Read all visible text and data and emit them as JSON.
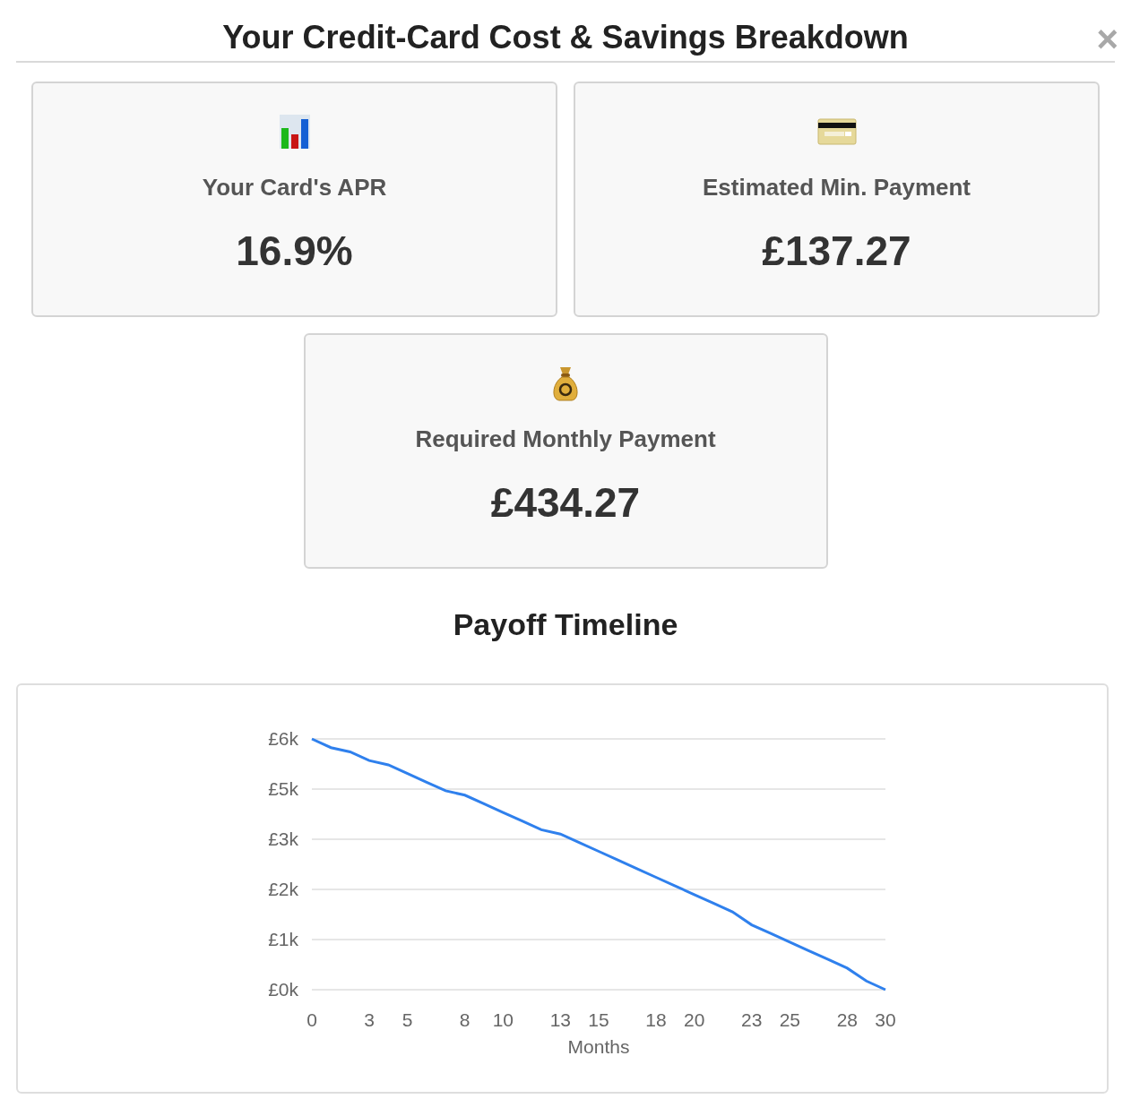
{
  "dialog": {
    "title": "Your Credit-Card Cost & Savings Breakdown",
    "close": "×"
  },
  "stat_cards": [
    {
      "kind": "chart",
      "label": "Your Card's APR",
      "value": "16.9%"
    },
    {
      "kind": "card",
      "label": "Estimated Min. Payment",
      "value": "£137.27"
    },
    {
      "kind": "moneybag",
      "label": "Required Monthly Payment",
      "value": "£434.27"
    }
  ],
  "payoff_section": {
    "chart_data": {
      "type": "line",
      "title": "Payoff Timeline",
      "xlabel": "Months",
      "x": [
        0,
        1,
        2,
        3,
        4,
        5,
        6,
        7,
        8,
        9,
        10,
        11,
        12,
        13,
        14,
        15,
        16,
        17,
        18,
        19,
        20,
        21,
        22,
        23,
        24,
        25,
        26,
        27,
        28,
        29,
        30
      ],
      "series": [
        {
          "color": "#2f80ed",
          "values": [
            5.8,
            5.6,
            5.5,
            5.3,
            5.2,
            5.0,
            4.8,
            4.6,
            4.5,
            4.3,
            4.1,
            3.9,
            3.7,
            3.6,
            3.4,
            3.2,
            3.0,
            2.8,
            2.6,
            2.4,
            2.2,
            2.0,
            1.8,
            1.5,
            1.3,
            1.1,
            0.9,
            0.7,
            0.5,
            0.2,
            0
          ]
        }
      ],
      "xlim": [
        0,
        30
      ],
      "ylim": [
        0,
        5.8
      ],
      "grid": true,
      "xticks": [
        0,
        3,
        5,
        8,
        10,
        13,
        15,
        18,
        20,
        23,
        25,
        28,
        30
      ],
      "yticks": [
        {
          "value": 0,
          "label": "£0k"
        },
        {
          "value": 1.16,
          "label": "£1k"
        },
        {
          "value": 2.32,
          "label": "£2k"
        },
        {
          "value": 3.48,
          "label": "£3k"
        },
        {
          "value": 4.64,
          "label": "£5k"
        },
        {
          "value": 5.8,
          "label": "£6k"
        }
      ]
    }
  }
}
